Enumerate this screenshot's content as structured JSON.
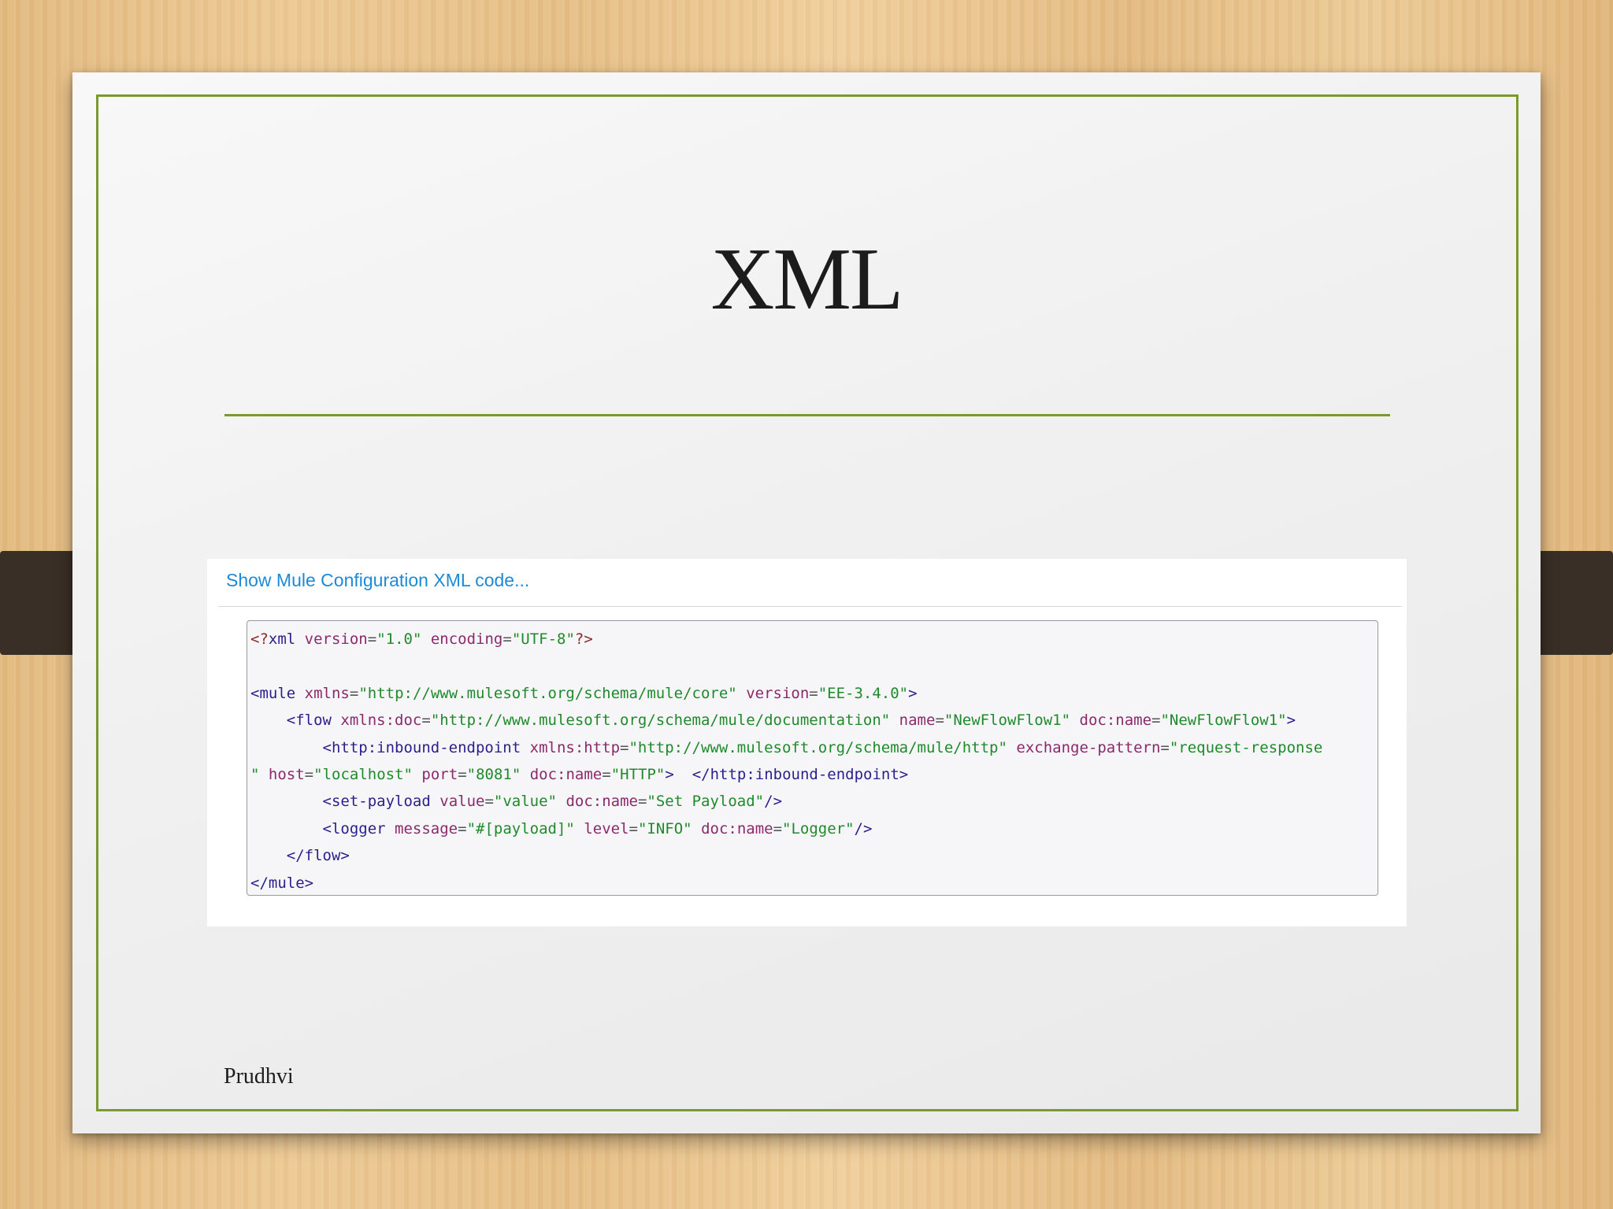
{
  "slide": {
    "title": "XML",
    "footer": "Prudhvi"
  },
  "panel": {
    "link_label": "Show Mule Configuration XML code...",
    "code_lines": [
      [
        {
          "t": "decl",
          "s": "<?"
        },
        {
          "t": "tag",
          "s": "xml"
        },
        {
          "t": "plain",
          "s": " "
        },
        {
          "t": "attr",
          "s": "version"
        },
        {
          "t": "punc",
          "s": "="
        },
        {
          "t": "val",
          "s": "\"1.0\""
        },
        {
          "t": "plain",
          "s": " "
        },
        {
          "t": "attr",
          "s": "encoding"
        },
        {
          "t": "punc",
          "s": "="
        },
        {
          "t": "val",
          "s": "\"UTF-8\""
        },
        {
          "t": "decl",
          "s": "?>"
        }
      ],
      [],
      [
        {
          "t": "tag",
          "s": "<mule"
        },
        {
          "t": "plain",
          "s": " "
        },
        {
          "t": "attr",
          "s": "xmlns"
        },
        {
          "t": "punc",
          "s": "="
        },
        {
          "t": "val",
          "s": "\"http://www.mulesoft.org/schema/mule/core\""
        },
        {
          "t": "plain",
          "s": " "
        },
        {
          "t": "attr",
          "s": "version"
        },
        {
          "t": "punc",
          "s": "="
        },
        {
          "t": "val",
          "s": "\"EE-3.4.0\""
        },
        {
          "t": "tag",
          "s": ">"
        }
      ],
      [
        {
          "t": "plain",
          "s": "    "
        },
        {
          "t": "tag",
          "s": "<flow"
        },
        {
          "t": "plain",
          "s": " "
        },
        {
          "t": "attr",
          "s": "xmlns:doc"
        },
        {
          "t": "punc",
          "s": "="
        },
        {
          "t": "val",
          "s": "\"http://www.mulesoft.org/schema/mule/documentation\""
        },
        {
          "t": "plain",
          "s": " "
        },
        {
          "t": "attr",
          "s": "name"
        },
        {
          "t": "punc",
          "s": "="
        },
        {
          "t": "val",
          "s": "\"NewFlowFlow1\""
        },
        {
          "t": "plain",
          "s": " "
        },
        {
          "t": "attr",
          "s": "doc:name"
        },
        {
          "t": "punc",
          "s": "="
        },
        {
          "t": "val",
          "s": "\"NewFlowFlow1\""
        },
        {
          "t": "tag",
          "s": ">"
        }
      ],
      [
        {
          "t": "plain",
          "s": "        "
        },
        {
          "t": "tag",
          "s": "<http:inbound-endpoint"
        },
        {
          "t": "plain",
          "s": " "
        },
        {
          "t": "attr",
          "s": "xmlns:http"
        },
        {
          "t": "punc",
          "s": "="
        },
        {
          "t": "val",
          "s": "\"http://www.mulesoft.org/schema/mule/http\""
        },
        {
          "t": "plain",
          "s": " "
        },
        {
          "t": "attr",
          "s": "exchange-pattern"
        },
        {
          "t": "punc",
          "s": "="
        },
        {
          "t": "val",
          "s": "\"request-response"
        }
      ],
      [
        {
          "t": "val",
          "s": "\""
        },
        {
          "t": "plain",
          "s": " "
        },
        {
          "t": "attr",
          "s": "host"
        },
        {
          "t": "punc",
          "s": "="
        },
        {
          "t": "val",
          "s": "\"localhost\""
        },
        {
          "t": "plain",
          "s": " "
        },
        {
          "t": "attr",
          "s": "port"
        },
        {
          "t": "punc",
          "s": "="
        },
        {
          "t": "val",
          "s": "\"8081\""
        },
        {
          "t": "plain",
          "s": " "
        },
        {
          "t": "attr",
          "s": "doc:name"
        },
        {
          "t": "punc",
          "s": "="
        },
        {
          "t": "val",
          "s": "\"HTTP\""
        },
        {
          "t": "tag",
          "s": ">"
        },
        {
          "t": "plain",
          "s": "  "
        },
        {
          "t": "tag",
          "s": "</http:inbound-endpoint>"
        }
      ],
      [
        {
          "t": "plain",
          "s": "        "
        },
        {
          "t": "tag",
          "s": "<set-payload"
        },
        {
          "t": "plain",
          "s": " "
        },
        {
          "t": "attr",
          "s": "value"
        },
        {
          "t": "punc",
          "s": "="
        },
        {
          "t": "val",
          "s": "\"value\""
        },
        {
          "t": "plain",
          "s": " "
        },
        {
          "t": "attr",
          "s": "doc:name"
        },
        {
          "t": "punc",
          "s": "="
        },
        {
          "t": "val",
          "s": "\"Set Payload\""
        },
        {
          "t": "tag",
          "s": "/>"
        }
      ],
      [
        {
          "t": "plain",
          "s": "        "
        },
        {
          "t": "tag",
          "s": "<logger"
        },
        {
          "t": "plain",
          "s": " "
        },
        {
          "t": "attr",
          "s": "message"
        },
        {
          "t": "punc",
          "s": "="
        },
        {
          "t": "val",
          "s": "\"#[payload]\""
        },
        {
          "t": "plain",
          "s": " "
        },
        {
          "t": "attr",
          "s": "level"
        },
        {
          "t": "punc",
          "s": "="
        },
        {
          "t": "val",
          "s": "\"INFO\""
        },
        {
          "t": "plain",
          "s": " "
        },
        {
          "t": "attr",
          "s": "doc:name"
        },
        {
          "t": "punc",
          "s": "="
        },
        {
          "t": "val",
          "s": "\"Logger\""
        },
        {
          "t": "tag",
          "s": "/>"
        }
      ],
      [
        {
          "t": "plain",
          "s": "    "
        },
        {
          "t": "tag",
          "s": "</flow>"
        }
      ],
      [
        {
          "t": "tag",
          "s": "</mule>"
        }
      ]
    ]
  },
  "colors": {
    "accent_green": "#7b9a2d",
    "link_blue": "#1e8ad6",
    "clip_brown": "#3a2f26"
  }
}
